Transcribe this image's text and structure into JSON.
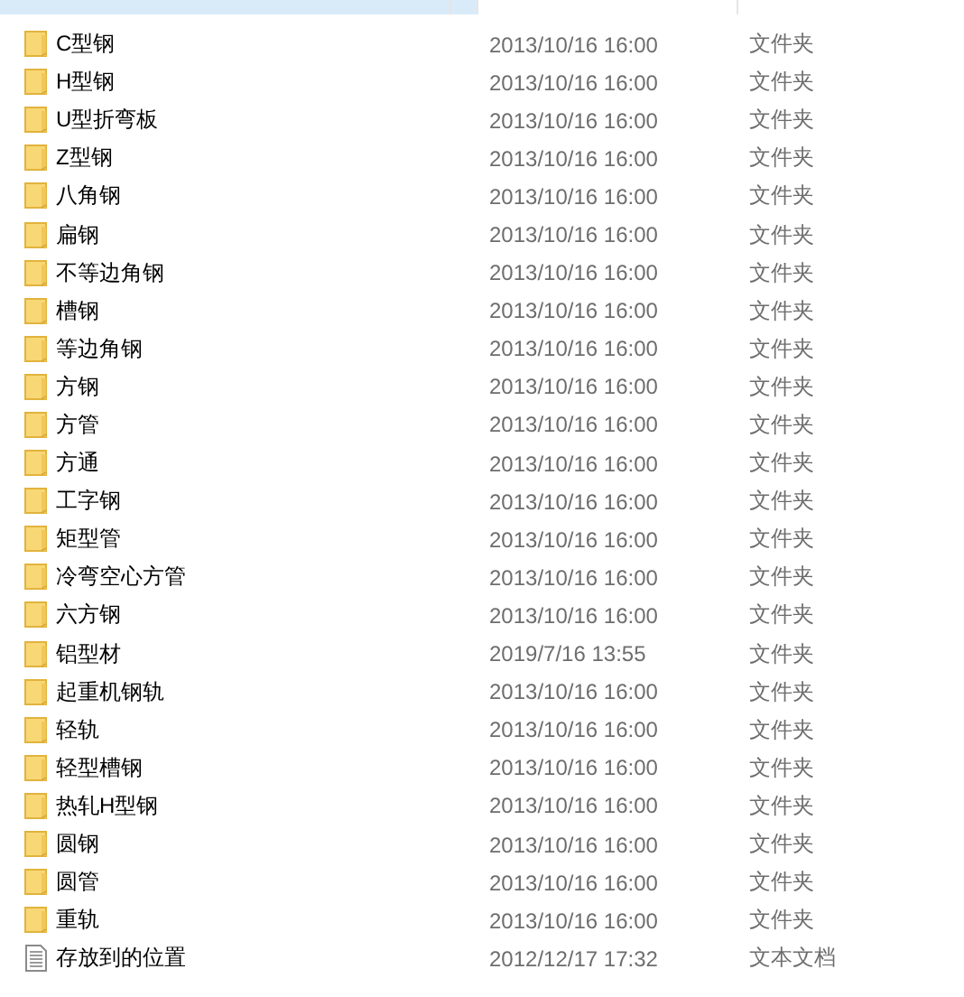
{
  "files": [
    {
      "kind": "folder",
      "name": "C型钢",
      "date": "2013/10/16 16:00",
      "type": "文件夹"
    },
    {
      "kind": "folder",
      "name": "H型钢",
      "date": "2013/10/16 16:00",
      "type": "文件夹"
    },
    {
      "kind": "folder",
      "name": "U型折弯板",
      "date": "2013/10/16 16:00",
      "type": "文件夹"
    },
    {
      "kind": "folder",
      "name": "Z型钢",
      "date": "2013/10/16 16:00",
      "type": "文件夹"
    },
    {
      "kind": "folder",
      "name": "八角钢",
      "date": "2013/10/16 16:00",
      "type": "文件夹"
    },
    {
      "kind": "folder",
      "name": "扁钢",
      "date": "2013/10/16 16:00",
      "type": "文件夹"
    },
    {
      "kind": "folder",
      "name": "不等边角钢",
      "date": "2013/10/16 16:00",
      "type": "文件夹"
    },
    {
      "kind": "folder",
      "name": "槽钢",
      "date": "2013/10/16 16:00",
      "type": "文件夹"
    },
    {
      "kind": "folder",
      "name": "等边角钢",
      "date": "2013/10/16 16:00",
      "type": "文件夹"
    },
    {
      "kind": "folder",
      "name": "方钢",
      "date": "2013/10/16 16:00",
      "type": "文件夹"
    },
    {
      "kind": "folder",
      "name": "方管",
      "date": "2013/10/16 16:00",
      "type": "文件夹"
    },
    {
      "kind": "folder",
      "name": "方通",
      "date": "2013/10/16 16:00",
      "type": "文件夹"
    },
    {
      "kind": "folder",
      "name": "工字钢",
      "date": "2013/10/16 16:00",
      "type": "文件夹"
    },
    {
      "kind": "folder",
      "name": "矩型管",
      "date": "2013/10/16 16:00",
      "type": "文件夹"
    },
    {
      "kind": "folder",
      "name": "冷弯空心方管",
      "date": "2013/10/16 16:00",
      "type": "文件夹"
    },
    {
      "kind": "folder",
      "name": "六方钢",
      "date": "2013/10/16 16:00",
      "type": "文件夹"
    },
    {
      "kind": "folder",
      "name": "铝型材",
      "date": "2019/7/16 13:55",
      "type": "文件夹"
    },
    {
      "kind": "folder",
      "name": "起重机钢轨",
      "date": "2013/10/16 16:00",
      "type": "文件夹"
    },
    {
      "kind": "folder",
      "name": "轻轨",
      "date": "2013/10/16 16:00",
      "type": "文件夹"
    },
    {
      "kind": "folder",
      "name": "轻型槽钢",
      "date": "2013/10/16 16:00",
      "type": "文件夹"
    },
    {
      "kind": "folder",
      "name": "热轧H型钢",
      "date": "2013/10/16 16:00",
      "type": "文件夹"
    },
    {
      "kind": "folder",
      "name": "圆钢",
      "date": "2013/10/16 16:00",
      "type": "文件夹"
    },
    {
      "kind": "folder",
      "name": "圆管",
      "date": "2013/10/16 16:00",
      "type": "文件夹"
    },
    {
      "kind": "folder",
      "name": "重轨",
      "date": "2013/10/16 16:00",
      "type": "文件夹"
    },
    {
      "kind": "text",
      "name": "存放到的位置",
      "date": "2012/12/17 17:32",
      "type": "文本文档"
    }
  ]
}
